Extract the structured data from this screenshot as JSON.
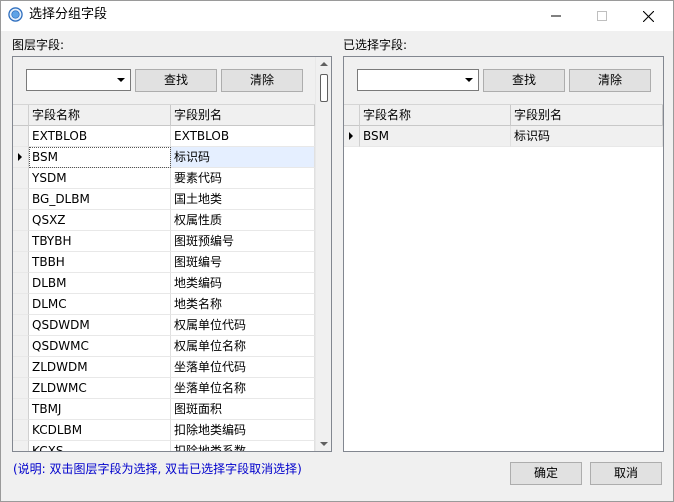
{
  "window": {
    "title": "选择分组字段",
    "controls": {
      "minimize": "–",
      "maximize": "☐",
      "close": "✕"
    }
  },
  "left": {
    "label": "图层字段:",
    "combo_value": "",
    "search_button": "查找",
    "clear_button": "清除",
    "columns": [
      "字段名称",
      "字段别名"
    ],
    "rows": [
      [
        "EXTBLOB",
        "EXTBLOB"
      ],
      [
        "BSM",
        "标识码"
      ],
      [
        "YSDM",
        "要素代码"
      ],
      [
        "BG_DLBM",
        "国土地类"
      ],
      [
        "QSXZ",
        "权属性质"
      ],
      [
        "TBYBH",
        "图斑预编号"
      ],
      [
        "TBBH",
        "图斑编号"
      ],
      [
        "DLBM",
        "地类编码"
      ],
      [
        "DLMC",
        "地类名称"
      ],
      [
        "QSDWDM",
        "权属单位代码"
      ],
      [
        "QSDWMC",
        "权属单位名称"
      ],
      [
        "ZLDWDM",
        "坐落单位代码"
      ],
      [
        "ZLDWMC",
        "坐落单位名称"
      ],
      [
        "TBMJ",
        "图斑面积"
      ],
      [
        "KCDLBM",
        "扣除地类编码"
      ],
      [
        "KCXS",
        "扣除地类系数"
      ]
    ],
    "current_row": 1
  },
  "right": {
    "label": "已选择字段:",
    "combo_value": "",
    "search_button": "查找",
    "clear_button": "清除",
    "columns": [
      "字段名称",
      "字段别名"
    ],
    "rows": [
      [
        "BSM",
        "标识码"
      ]
    ]
  },
  "hint": "(说明: 双击图层字段为选择, 双击已选择字段取消选择)",
  "ok_button": "确定",
  "cancel_button": "取消"
}
